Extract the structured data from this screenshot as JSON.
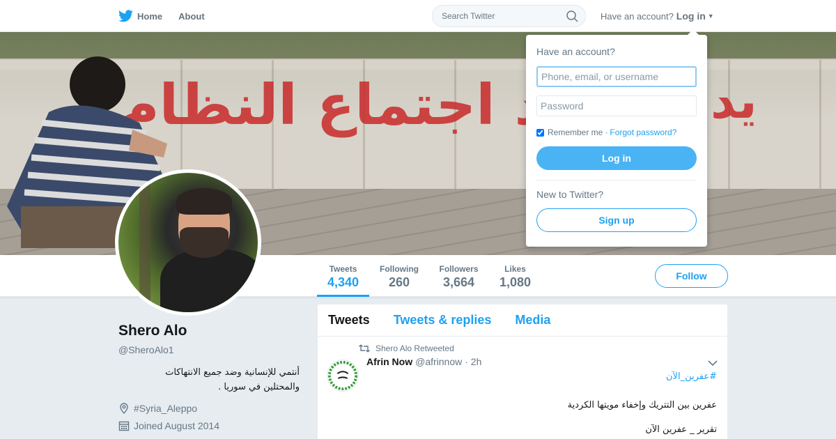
{
  "topbar": {
    "nav": [
      {
        "label": "Home",
        "icon": "twitter-bird-icon"
      },
      {
        "label": "About"
      }
    ],
    "search": {
      "placeholder": "Search Twitter",
      "value": ""
    },
    "login_prompt": {
      "text": "Have an account?",
      "link": "Log in"
    }
  },
  "banner": {
    "graffiti_left": "ـيد اجتماع النظام",
    "graffiti_right": "يد"
  },
  "profile_nav": {
    "stats": [
      {
        "label": "Tweets",
        "value": "4,340",
        "active": true
      },
      {
        "label": "Following",
        "value": "260"
      },
      {
        "label": "Followers",
        "value": "3,664"
      },
      {
        "label": "Likes",
        "value": "1,080"
      }
    ],
    "follow_label": "Follow"
  },
  "profile": {
    "name": "Shero Alo",
    "handle": "@SheroAlo1",
    "bio_line1": "أنتمي للإنسانية وضد جميع الانتهاكات",
    "bio_line2": "والمحتلين في سوريا .",
    "location": "#Syria_Aleppo",
    "joined": "Joined August 2014"
  },
  "timeline": {
    "tabs": [
      {
        "label": "Tweets",
        "active": true
      },
      {
        "label": "Tweets & replies"
      },
      {
        "label": "Media"
      }
    ],
    "tweet": {
      "retweet_context": "Shero Alo Retweeted",
      "author": "Afrin Now",
      "handle": "@afrinnow",
      "time": "· 2h",
      "hashtag": "#عفرين_الآن",
      "line1": "عفرين بين التتريك وإخفاء مويتها الكردية",
      "line2": "تقرير _ عفرين الآن"
    }
  },
  "login_dropdown": {
    "heading": "Have an account?",
    "username_placeholder": "Phone, email, or username",
    "password_placeholder": "Password",
    "remember_label": "Remember me",
    "separator": "·",
    "forgot_label": "Forgot password?",
    "login_label": "Log in",
    "new_heading": "New to Twitter?",
    "signup_label": "Sign up"
  },
  "colors": {
    "accent": "#1da1f2",
    "login_button": "#4ab3f4",
    "background": "#e6ecf0",
    "graffiti": "#c92a2a"
  }
}
